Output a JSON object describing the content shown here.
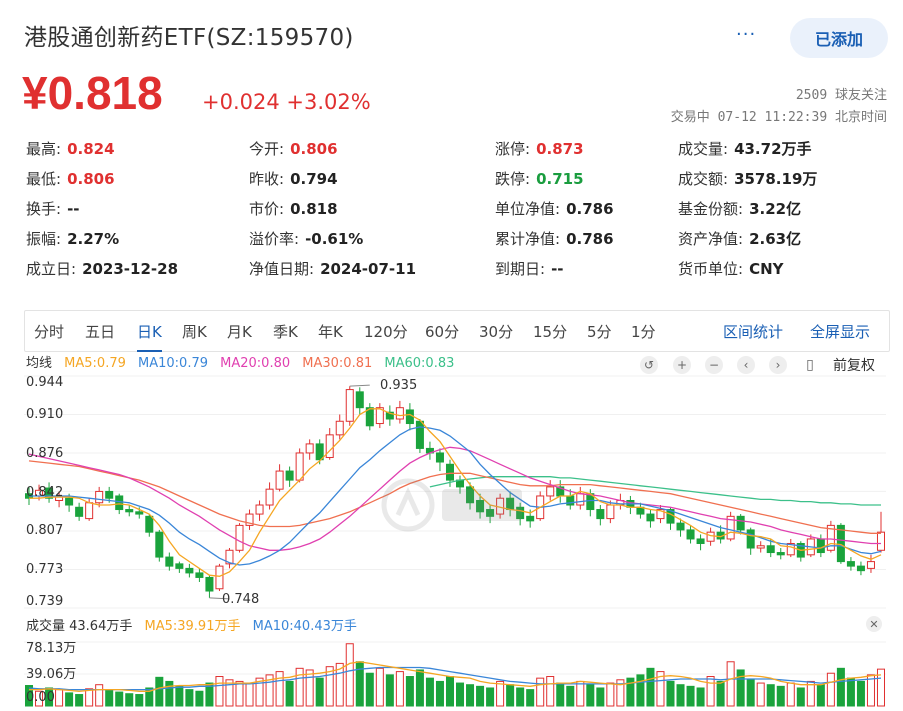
{
  "header": {
    "title": "港股通创新药ETF(SZ:159570)",
    "more_label": "···",
    "added_label": "已添加"
  },
  "quote": {
    "price": "¥0.818",
    "change": "+0.024 +3.02%",
    "followers": "2509 球友关注",
    "trade_status": "交易中 07-12 11:22:39 北京时间"
  },
  "stats": {
    "high": {
      "label": "最高:",
      "value": "0.824"
    },
    "open": {
      "label": "今开:",
      "value": "0.806"
    },
    "limit_up": {
      "label": "涨停:",
      "value": "0.873"
    },
    "volume": {
      "label": "成交量:",
      "value": "43.72万手"
    },
    "low": {
      "label": "最低:",
      "value": "0.806"
    },
    "prev_close": {
      "label": "昨收:",
      "value": "0.794"
    },
    "limit_down": {
      "label": "跌停:",
      "value": "0.715"
    },
    "turnover_amt": {
      "label": "成交额:",
      "value": "3578.19万"
    },
    "turnover_rate": {
      "label": "换手:",
      "value": "--"
    },
    "mkt_price": {
      "label": "市价:",
      "value": "0.818"
    },
    "unit_nav": {
      "label": "单位净值:",
      "value": "0.786"
    },
    "fund_shares": {
      "label": "基金份额:",
      "value": "3.22亿"
    },
    "amplitude": {
      "label": "振幅:",
      "value": "2.27%"
    },
    "premium": {
      "label": "溢价率:",
      "value": "-0.61%"
    },
    "accum_nav": {
      "label": "累计净值:",
      "value": "0.786"
    },
    "net_assets": {
      "label": "资产净值:",
      "value": "2.63亿"
    },
    "inception": {
      "label": "成立日:",
      "value": "2023-12-28"
    },
    "nav_date": {
      "label": "净值日期:",
      "value": "2024-07-11"
    },
    "maturity": {
      "label": "到期日:",
      "value": "--"
    },
    "currency": {
      "label": "货币单位:",
      "value": "CNY"
    }
  },
  "tabs": [
    "分时",
    "五日",
    "日K",
    "周K",
    "月K",
    "季K",
    "年K",
    "120分",
    "60分",
    "30分",
    "15分",
    "5分",
    "1分"
  ],
  "active_tab": "日K",
  "tab_right": [
    "区间统计",
    "全屏显示"
  ],
  "ma_legend": {
    "title": "均线",
    "ma5": "MA5:0.79",
    "ma10": "MA10:0.79",
    "ma20": "MA20:0.80",
    "ma30": "MA30:0.81",
    "ma60": "MA60:0.83"
  },
  "restore_label": "前复权",
  "vol_legend": {
    "volume": "成交量 43.64万手",
    "ma5": "MA5:39.91万手",
    "ma10": "MA10:40.43万手"
  },
  "colors": {
    "up": "#e03030",
    "down": "#1aa33c",
    "ma5": "#f5a623",
    "ma10": "#3a86d8",
    "ma20": "#e040b0",
    "ma30": "#f07050",
    "ma60": "#3cc08a"
  },
  "chart_data": {
    "type": "candlestick",
    "y_ticks": [
      "0.944",
      "0.910",
      "0.876",
      "0.842",
      "0.807",
      "0.773",
      "0.739"
    ],
    "ylim": [
      0.739,
      0.944
    ],
    "annotations": [
      "0.935",
      "0.748"
    ],
    "volume_ticks": [
      "78.13万",
      "39.06万",
      "0.00"
    ],
    "volume_ylim": [
      0,
      78.13
    ],
    "candles": [
      [
        0.84,
        0.836,
        0.846,
        0.83
      ],
      [
        0.838,
        0.843,
        0.848,
        0.834
      ],
      [
        0.845,
        0.836,
        0.85,
        0.832
      ],
      [
        0.834,
        0.838,
        0.842,
        0.828
      ],
      [
        0.836,
        0.83,
        0.84,
        0.824
      ],
      [
        0.828,
        0.82,
        0.832,
        0.816
      ],
      [
        0.818,
        0.832,
        0.836,
        0.816
      ],
      [
        0.832,
        0.842,
        0.846,
        0.828
      ],
      [
        0.842,
        0.836,
        0.846,
        0.832
      ],
      [
        0.838,
        0.826,
        0.84,
        0.822
      ],
      [
        0.826,
        0.824,
        0.83,
        0.82
      ],
      [
        0.824,
        0.822,
        0.828,
        0.818
      ],
      [
        0.82,
        0.806,
        0.822,
        0.802
      ],
      [
        0.806,
        0.784,
        0.808,
        0.78
      ],
      [
        0.784,
        0.776,
        0.788,
        0.772
      ],
      [
        0.778,
        0.774,
        0.78,
        0.77
      ],
      [
        0.774,
        0.77,
        0.778,
        0.766
      ],
      [
        0.77,
        0.766,
        0.774,
        0.762
      ],
      [
        0.766,
        0.754,
        0.768,
        0.748
      ],
      [
        0.756,
        0.776,
        0.778,
        0.754
      ],
      [
        0.778,
        0.79,
        0.792,
        0.774
      ],
      [
        0.79,
        0.812,
        0.814,
        0.788
      ],
      [
        0.812,
        0.822,
        0.826,
        0.808
      ],
      [
        0.822,
        0.83,
        0.834,
        0.816
      ],
      [
        0.83,
        0.844,
        0.85,
        0.826
      ],
      [
        0.844,
        0.86,
        0.866,
        0.842
      ],
      [
        0.86,
        0.852,
        0.864,
        0.846
      ],
      [
        0.852,
        0.876,
        0.88,
        0.85
      ],
      [
        0.876,
        0.884,
        0.888,
        0.87
      ],
      [
        0.884,
        0.87,
        0.888,
        0.866
      ],
      [
        0.872,
        0.892,
        0.898,
        0.87
      ],
      [
        0.892,
        0.904,
        0.91,
        0.888
      ],
      [
        0.904,
        0.932,
        0.935,
        0.9
      ],
      [
        0.93,
        0.916,
        0.934,
        0.91
      ],
      [
        0.916,
        0.9,
        0.92,
        0.896
      ],
      [
        0.902,
        0.916,
        0.92,
        0.898
      ],
      [
        0.912,
        0.906,
        0.918,
        0.9
      ],
      [
        0.906,
        0.916,
        0.922,
        0.902
      ],
      [
        0.914,
        0.902,
        0.92,
        0.896
      ],
      [
        0.904,
        0.88,
        0.906,
        0.876
      ],
      [
        0.88,
        0.876,
        0.886,
        0.87
      ],
      [
        0.876,
        0.868,
        0.88,
        0.86
      ],
      [
        0.866,
        0.852,
        0.87,
        0.846
      ],
      [
        0.852,
        0.846,
        0.856,
        0.84
      ],
      [
        0.846,
        0.832,
        0.85,
        0.826
      ],
      [
        0.834,
        0.824,
        0.84,
        0.818
      ],
      [
        0.826,
        0.82,
        0.83,
        0.814
      ],
      [
        0.822,
        0.836,
        0.84,
        0.818
      ],
      [
        0.836,
        0.826,
        0.842,
        0.82
      ],
      [
        0.828,
        0.818,
        0.832,
        0.812
      ],
      [
        0.82,
        0.816,
        0.826,
        0.81
      ],
      [
        0.818,
        0.838,
        0.842,
        0.816
      ],
      [
        0.838,
        0.846,
        0.852,
        0.834
      ],
      [
        0.846,
        0.838,
        0.852,
        0.832
      ],
      [
        0.838,
        0.83,
        0.844,
        0.826
      ],
      [
        0.83,
        0.84,
        0.846,
        0.826
      ],
      [
        0.84,
        0.826,
        0.844,
        0.82
      ],
      [
        0.826,
        0.818,
        0.83,
        0.812
      ],
      [
        0.818,
        0.83,
        0.834,
        0.814
      ],
      [
        0.83,
        0.834,
        0.84,
        0.826
      ],
      [
        0.834,
        0.828,
        0.838,
        0.822
      ],
      [
        0.828,
        0.822,
        0.832,
        0.818
      ],
      [
        0.822,
        0.816,
        0.826,
        0.81
      ],
      [
        0.818,
        0.826,
        0.83,
        0.814
      ],
      [
        0.826,
        0.814,
        0.828,
        0.808
      ],
      [
        0.814,
        0.808,
        0.818,
        0.802
      ],
      [
        0.808,
        0.8,
        0.812,
        0.796
      ],
      [
        0.8,
        0.796,
        0.804,
        0.79
      ],
      [
        0.798,
        0.806,
        0.81,
        0.794
      ],
      [
        0.806,
        0.8,
        0.812,
        0.796
      ],
      [
        0.8,
        0.82,
        0.824,
        0.798
      ],
      [
        0.82,
        0.808,
        0.822,
        0.804
      ],
      [
        0.808,
        0.792,
        0.81,
        0.786
      ],
      [
        0.792,
        0.794,
        0.798,
        0.788
      ],
      [
        0.794,
        0.788,
        0.8,
        0.784
      ],
      [
        0.788,
        0.786,
        0.792,
        0.782
      ],
      [
        0.786,
        0.796,
        0.8,
        0.784
      ],
      [
        0.796,
        0.784,
        0.798,
        0.78
      ],
      [
        0.786,
        0.8,
        0.804,
        0.784
      ],
      [
        0.8,
        0.788,
        0.804,
        0.784
      ],
      [
        0.79,
        0.812,
        0.816,
        0.788
      ],
      [
        0.812,
        0.78,
        0.814,
        0.778
      ],
      [
        0.78,
        0.776,
        0.784,
        0.772
      ],
      [
        0.776,
        0.772,
        0.78,
        0.768
      ],
      [
        0.774,
        0.78,
        0.786,
        0.77
      ],
      [
        0.79,
        0.806,
        0.824,
        0.788
      ]
    ],
    "volumes": [
      25,
      18,
      22,
      20,
      16,
      14,
      21,
      26,
      19,
      17,
      15,
      14,
      22,
      35,
      30,
      24,
      20,
      18,
      28,
      36,
      32,
      30,
      28,
      34,
      38,
      42,
      30,
      46,
      44,
      34,
      48,
      52,
      76,
      54,
      40,
      46,
      38,
      42,
      36,
      44,
      34,
      30,
      36,
      28,
      26,
      24,
      22,
      30,
      26,
      22,
      20,
      34,
      36,
      28,
      24,
      30,
      26,
      22,
      28,
      32,
      34,
      38,
      46,
      42,
      30,
      26,
      24,
      22,
      36,
      30,
      54,
      44,
      32,
      28,
      26,
      24,
      28,
      22,
      30,
      26,
      40,
      46,
      34,
      30,
      38,
      45
    ],
    "ma5": [
      0.836,
      0.836,
      0.837,
      0.837,
      0.837,
      0.836,
      0.832,
      0.83,
      0.83,
      0.831,
      0.83,
      0.826,
      0.822,
      0.812,
      0.798,
      0.786,
      0.78,
      0.774,
      0.768,
      0.767,
      0.771,
      0.78,
      0.79,
      0.806,
      0.82,
      0.834,
      0.843,
      0.852,
      0.862,
      0.869,
      0.878,
      0.887,
      0.898,
      0.91,
      0.915,
      0.915,
      0.911,
      0.909,
      0.91,
      0.905,
      0.895,
      0.886,
      0.873,
      0.86,
      0.848,
      0.838,
      0.83,
      0.828,
      0.826,
      0.825,
      0.823,
      0.828,
      0.833,
      0.838,
      0.838,
      0.842,
      0.84,
      0.833,
      0.83,
      0.83,
      0.828,
      0.828,
      0.826,
      0.825,
      0.822,
      0.817,
      0.812,
      0.806,
      0.803,
      0.802,
      0.806,
      0.805,
      0.803,
      0.802,
      0.8,
      0.794,
      0.793,
      0.79,
      0.791,
      0.792,
      0.796,
      0.795,
      0.79,
      0.785,
      0.782,
      0.786
    ],
    "ma10": [
      0.838,
      0.838,
      0.838,
      0.838,
      0.838,
      0.837,
      0.836,
      0.835,
      0.834,
      0.833,
      0.832,
      0.829,
      0.826,
      0.821,
      0.814,
      0.806,
      0.8,
      0.795,
      0.789,
      0.783,
      0.779,
      0.777,
      0.778,
      0.781,
      0.785,
      0.79,
      0.797,
      0.806,
      0.815,
      0.823,
      0.833,
      0.843,
      0.853,
      0.863,
      0.87,
      0.878,
      0.885,
      0.892,
      0.897,
      0.899,
      0.898,
      0.896,
      0.891,
      0.884,
      0.877,
      0.866,
      0.857,
      0.849,
      0.841,
      0.835,
      0.829,
      0.828,
      0.829,
      0.831,
      0.832,
      0.833,
      0.834,
      0.834,
      0.832,
      0.831,
      0.831,
      0.831,
      0.829,
      0.827,
      0.825,
      0.822,
      0.819,
      0.816,
      0.813,
      0.81,
      0.808,
      0.806,
      0.804,
      0.801,
      0.798,
      0.796,
      0.795,
      0.794,
      0.793,
      0.792,
      0.794,
      0.794,
      0.791,
      0.788,
      0.787,
      0.789
    ],
    "ma20": [
      0.875,
      0.873,
      0.871,
      0.869,
      0.867,
      0.865,
      0.863,
      0.861,
      0.859,
      0.857,
      0.854,
      0.85,
      0.846,
      0.841,
      0.836,
      0.83,
      0.825,
      0.82,
      0.814,
      0.808,
      0.803,
      0.798,
      0.794,
      0.792,
      0.79,
      0.79,
      0.791,
      0.793,
      0.796,
      0.8,
      0.806,
      0.813,
      0.82,
      0.828,
      0.836,
      0.844,
      0.852,
      0.86,
      0.867,
      0.872,
      0.876,
      0.879,
      0.881,
      0.88,
      0.878,
      0.874,
      0.87,
      0.866,
      0.862,
      0.858,
      0.854,
      0.851,
      0.848,
      0.845,
      0.842,
      0.84,
      0.839,
      0.838,
      0.836,
      0.834,
      0.832,
      0.831,
      0.83,
      0.829,
      0.828,
      0.826,
      0.824,
      0.822,
      0.82,
      0.818,
      0.817,
      0.816,
      0.815,
      0.813,
      0.811,
      0.808,
      0.806,
      0.804,
      0.802,
      0.8,
      0.8,
      0.799,
      0.798,
      0.797,
      0.796,
      0.796
    ],
    "ma30": [
      0.869,
      0.868,
      0.867,
      0.866,
      0.865,
      0.864,
      0.862,
      0.86,
      0.858,
      0.856,
      0.854,
      0.852,
      0.849,
      0.846,
      0.842,
      0.838,
      0.834,
      0.83,
      0.826,
      0.822,
      0.819,
      0.816,
      0.814,
      0.812,
      0.811,
      0.811,
      0.811,
      0.812,
      0.814,
      0.816,
      0.818,
      0.821,
      0.824,
      0.828,
      0.832,
      0.836,
      0.84,
      0.845,
      0.849,
      0.852,
      0.855,
      0.857,
      0.858,
      0.858,
      0.858,
      0.856,
      0.854,
      0.852,
      0.85,
      0.848,
      0.847,
      0.847,
      0.847,
      0.848,
      0.848,
      0.848,
      0.848,
      0.847,
      0.846,
      0.845,
      0.844,
      0.843,
      0.842,
      0.841,
      0.84,
      0.838,
      0.836,
      0.834,
      0.832,
      0.83,
      0.828,
      0.826,
      0.824,
      0.822,
      0.82,
      0.818,
      0.816,
      0.814,
      0.812,
      0.81,
      0.809,
      0.808,
      0.807,
      0.806,
      0.805,
      0.805
    ],
    "ma60": [
      null,
      null,
      null,
      null,
      null,
      null,
      null,
      null,
      null,
      null,
      null,
      null,
      null,
      null,
      null,
      null,
      null,
      null,
      null,
      null,
      null,
      null,
      null,
      null,
      null,
      null,
      null,
      null,
      null,
      null,
      null,
      null,
      null,
      null,
      null,
      null,
      null,
      null,
      null,
      null,
      0.846,
      0.848,
      0.85,
      0.852,
      0.853,
      0.854,
      0.855,
      0.855,
      0.855,
      0.855,
      0.855,
      0.855,
      0.855,
      0.854,
      0.854,
      0.853,
      0.852,
      0.851,
      0.85,
      0.849,
      0.848,
      0.847,
      0.846,
      0.845,
      0.844,
      0.843,
      0.842,
      0.841,
      0.84,
      0.839,
      0.838,
      0.837,
      0.836,
      0.835,
      0.835,
      0.834,
      0.834,
      0.833,
      0.833,
      0.832,
      0.832,
      0.831,
      0.831,
      0.83,
      0.83,
      0.83
    ],
    "vol_ma5": [
      20,
      20,
      21,
      20,
      19,
      18,
      19,
      20,
      20,
      20,
      19,
      18,
      18,
      22,
      24,
      25,
      25,
      26,
      26,
      28,
      28,
      28,
      28,
      30,
      32,
      34,
      35,
      38,
      39,
      40,
      42,
      45,
      52,
      54,
      52,
      50,
      48,
      46,
      44,
      42,
      40,
      38,
      36,
      35,
      34,
      30,
      28,
      27,
      26,
      25,
      24,
      26,
      27,
      28,
      28,
      30,
      29,
      28,
      27,
      26,
      28,
      30,
      33,
      36,
      37,
      36,
      34,
      30,
      28,
      28,
      33,
      36,
      37,
      36,
      34,
      30,
      28,
      26,
      26,
      26,
      29,
      32,
      34,
      35,
      37,
      38
    ],
    "vol_ma10": [
      22,
      21,
      21,
      21,
      20,
      20,
      20,
      20,
      20,
      20,
      20,
      20,
      20,
      21,
      22,
      23,
      23,
      24,
      24,
      25,
      26,
      27,
      27,
      28,
      29,
      31,
      32,
      34,
      35,
      36,
      38,
      40,
      43,
      45,
      46,
      47,
      47,
      47,
      47,
      47,
      46,
      44,
      42,
      40,
      38,
      36,
      34,
      32,
      30,
      29,
      28,
      27,
      27,
      27,
      27,
      27,
      27,
      27,
      27,
      27,
      28,
      29,
      30,
      31,
      32,
      33,
      33,
      33,
      33,
      32,
      33,
      33,
      33,
      33,
      33,
      32,
      31,
      30,
      29,
      28,
      29,
      30,
      31,
      32,
      33,
      34
    ]
  }
}
